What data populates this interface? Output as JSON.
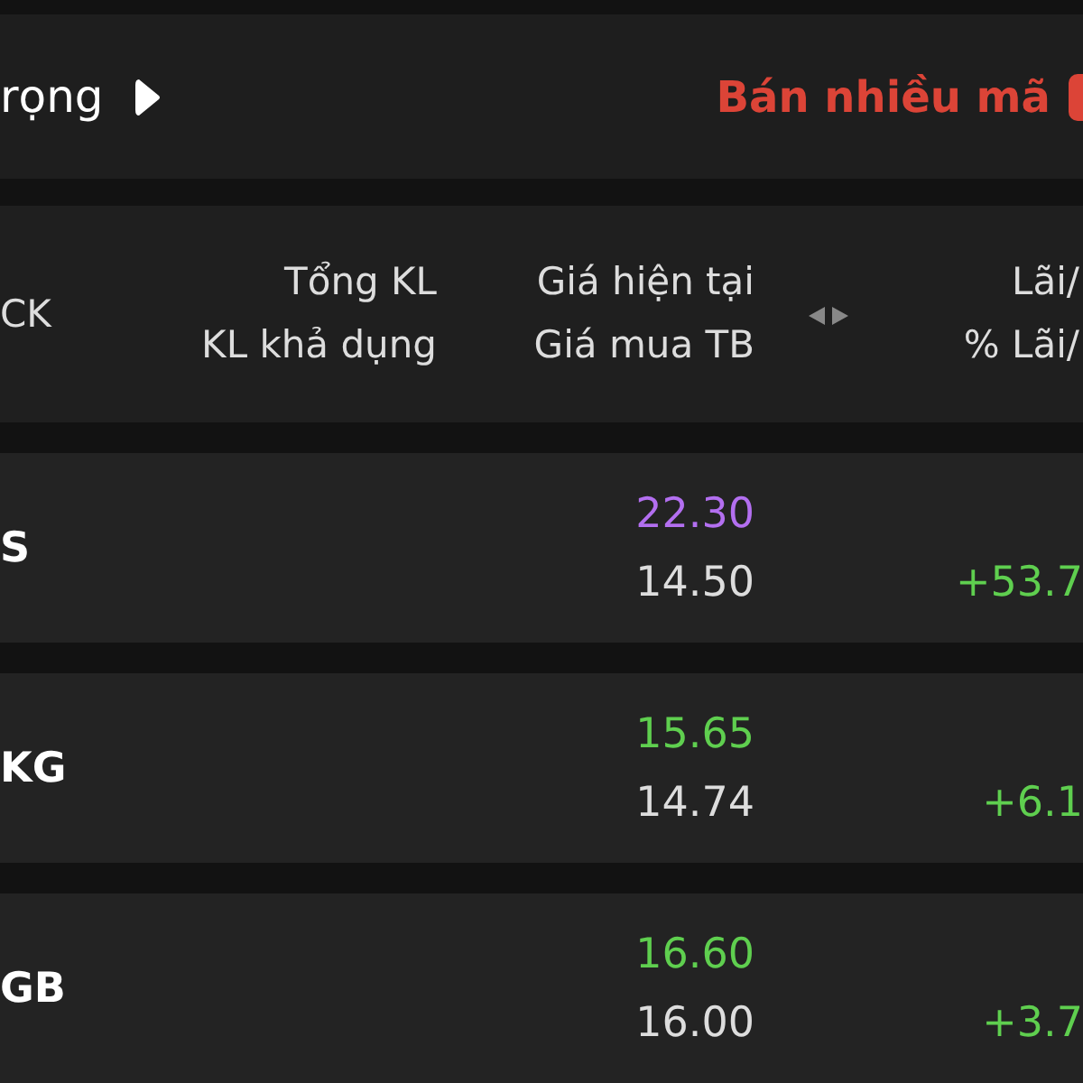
{
  "top_bar": {
    "title": "rọng",
    "action": "Bán nhiều mã"
  },
  "table": {
    "columns": [
      {
        "line_1": "CK"
      },
      {
        "line_1": "Tổng KL",
        "line_2": "KL khả dụng"
      },
      {
        "line_1": "Giá hiện tại",
        "line_2": "Giá mua TB"
      },
      {
        "line_1": "Lãi/",
        "line_2": "% Lãi/"
      }
    ],
    "rows": [
      {
        "symbol": "S",
        "current_price": "22.30",
        "color": "#b36ff0",
        "avg_price": "14.50",
        "pl_percent": "+53.7"
      },
      {
        "symbol": "KG",
        "current_price": "15.65",
        "color": "#5fcf4f",
        "avg_price": "14.74",
        "pl_percent": "+6.1"
      },
      {
        "symbol": "GB",
        "current_price": "16.60",
        "color": "#5fcf4f",
        "avg_price": "16.00",
        "pl_percent": "+3.7"
      }
    ]
  }
}
